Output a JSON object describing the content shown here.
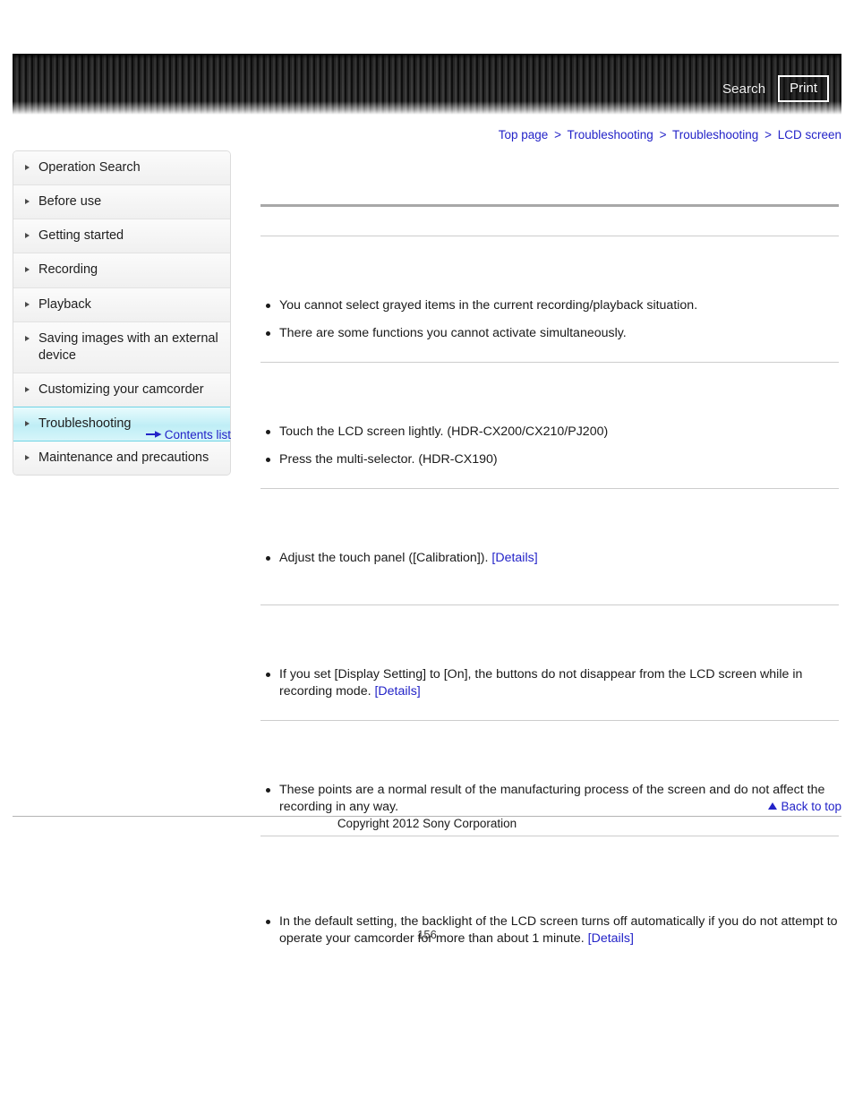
{
  "header": {
    "search_label": "Search",
    "print_label": "Print",
    "search_icon": "search-icon",
    "print_icon": "printer-icon"
  },
  "breadcrumb": {
    "items": [
      {
        "label": "Top page"
      },
      {
        "label": "Troubleshooting"
      },
      {
        "label": "Troubleshooting"
      },
      {
        "label": "LCD screen"
      }
    ],
    "separator": ">"
  },
  "sidebar": {
    "items": [
      {
        "label": "Operation Search",
        "active": false
      },
      {
        "label": "Before use",
        "active": false
      },
      {
        "label": "Getting started",
        "active": false
      },
      {
        "label": "Recording",
        "active": false
      },
      {
        "label": "Playback",
        "active": false
      },
      {
        "label": "Saving images with an external device",
        "active": false
      },
      {
        "label": "Customizing your camcorder",
        "active": false
      },
      {
        "label": "Troubleshooting",
        "active": true
      },
      {
        "label": "Maintenance and precautions",
        "active": false
      }
    ],
    "contents_list_label": "Contents list",
    "contents_list_icon": "arrow-right-icon"
  },
  "main": {
    "page_title": "",
    "sections": [
      {
        "heading": "",
        "bullets": [
          {
            "text": "You cannot select grayed items in the current recording/playback situation.",
            "link": ""
          },
          {
            "text": "There are some functions you cannot activate simultaneously.",
            "link": ""
          }
        ]
      },
      {
        "heading": "",
        "bullets": [
          {
            "text": "Touch the LCD screen lightly. (HDR-CX200/CX210/PJ200)",
            "link": ""
          },
          {
            "text": "Press the multi-selector. (HDR-CX190)",
            "link": ""
          }
        ]
      },
      {
        "heading": "",
        "bullets": [
          {
            "text": "Adjust the touch panel ([Calibration]).",
            "link": "[Details]"
          }
        ]
      },
      {
        "heading": "",
        "bullets": [
          {
            "text": "If you set [Display Setting] to [On], the buttons do not disappear from the LCD screen while in recording mode.",
            "link": "[Details]"
          }
        ]
      },
      {
        "heading": "",
        "bullets": [
          {
            "text": "These points are a normal result of the manufacturing process of the screen and do not affect the recording in any way.",
            "link": ""
          }
        ]
      },
      {
        "heading": "",
        "bullets": [
          {
            "text": "In the default setting, the backlight of the LCD screen turns off automatically if you do not attempt to operate your camcorder for more than about 1 minute.",
            "link": "[Details]"
          }
        ]
      }
    ]
  },
  "footer": {
    "back_to_top_label": "Back to top",
    "back_to_top_icon": "triangle-up-icon",
    "copyright": "Copyright 2012 Sony Corporation",
    "page_number": "156"
  },
  "colors": {
    "link": "#2323c8",
    "active_sidebar": "#bfeef6",
    "rule": "#cdcdcd",
    "rule_strong": "#a8a8a8"
  }
}
